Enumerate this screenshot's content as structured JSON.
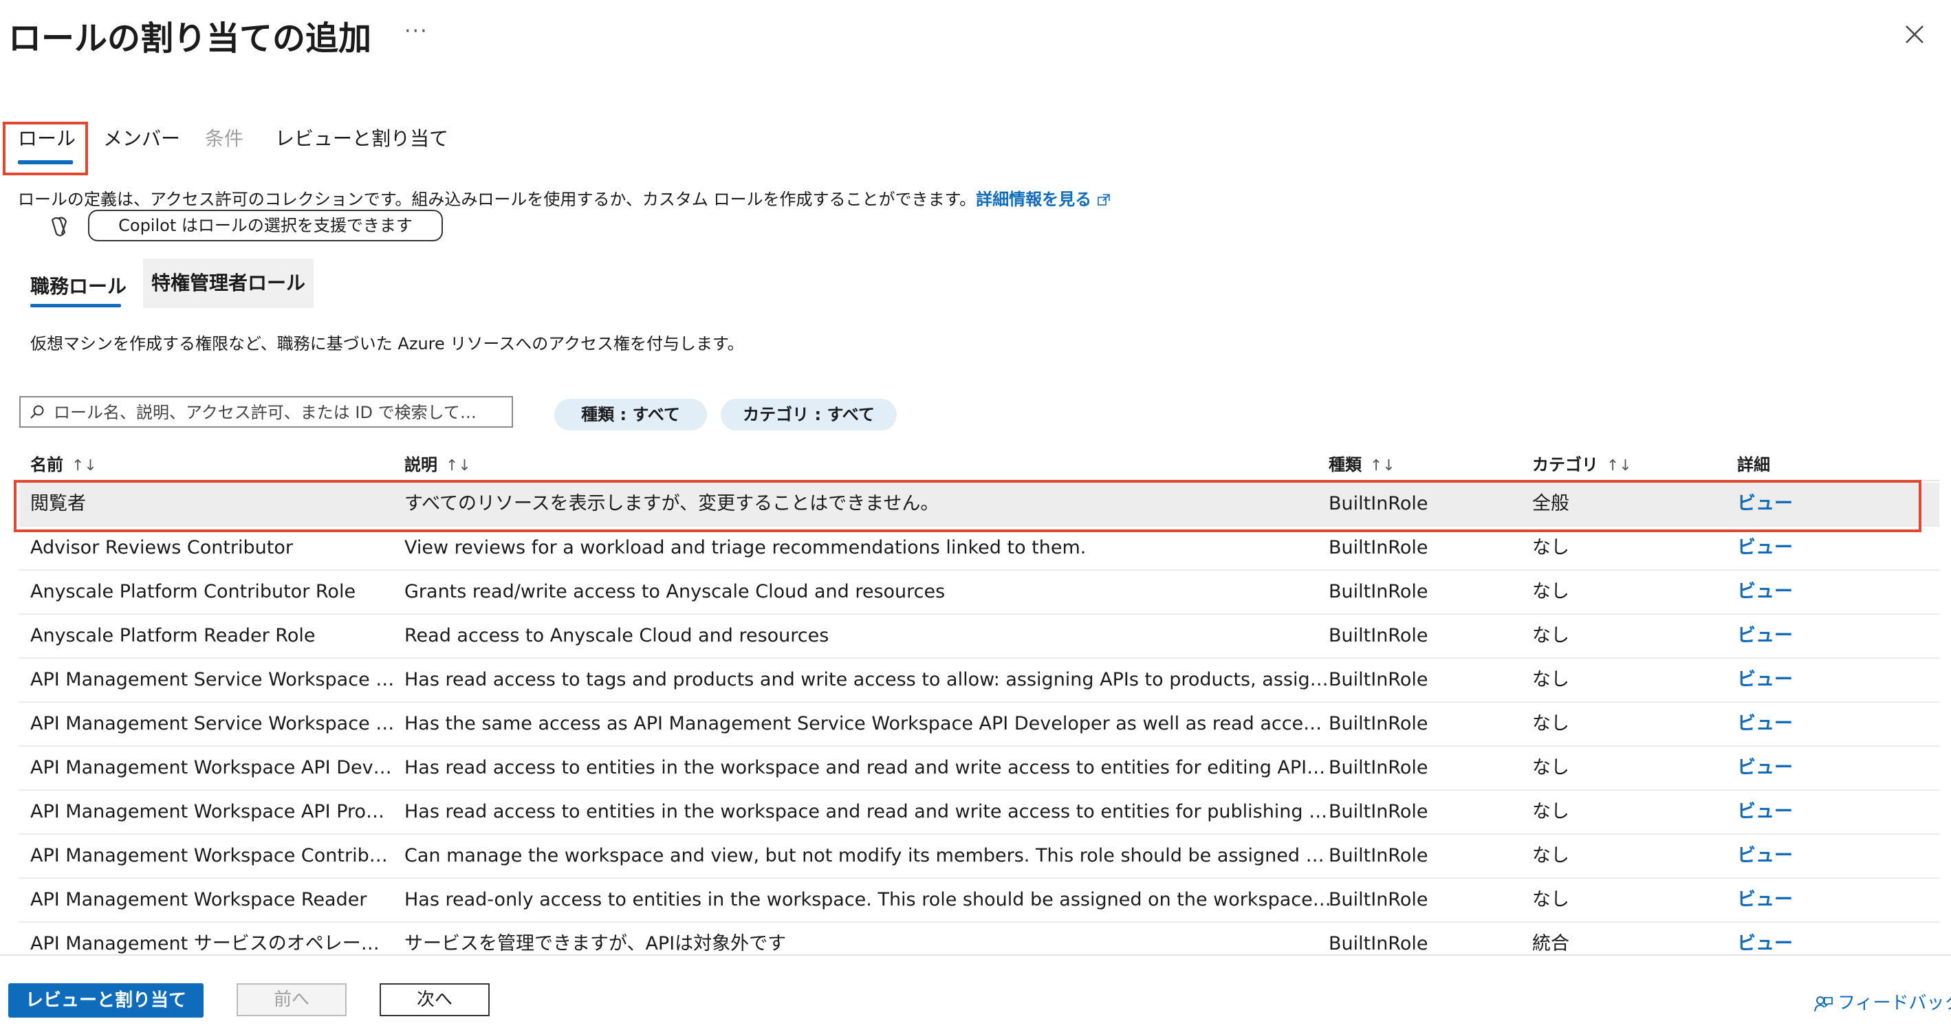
{
  "header": {
    "title": "ロールの割り当ての追加",
    "more": "···"
  },
  "tabs": [
    {
      "label": "ロール"
    },
    {
      "label": "メンバー"
    },
    {
      "label": "条件"
    },
    {
      "label": "レビューと割り当て"
    }
  ],
  "description": {
    "text": "ロールの定義は、アクセス許可のコレクションです。組み込みロールを使用するか、カスタム ロールを作成することができます。",
    "link": "詳細情報を見る"
  },
  "copilot": {
    "button_label": "Copilot はロールの選択を支援できます"
  },
  "subtabs": [
    {
      "label": "職務ロール"
    },
    {
      "label": "特権管理者ロール"
    }
  ],
  "subtab_description": "仮想マシンを作成する権限など、職務に基づいた Azure リソースへのアクセス権を付与します。",
  "search": {
    "placeholder": "ロール名、説明、アクセス許可、または ID で検索して…",
    "value": ""
  },
  "filters": [
    {
      "label": "種類 : すべて"
    },
    {
      "label": "カテゴリ : すべて"
    }
  ],
  "table": {
    "columns": {
      "name": "名前",
      "description": "説明",
      "type": "種類",
      "category": "カテゴリ",
      "details": "詳細"
    },
    "sort_glyph": "↑↓",
    "rows": [
      {
        "name": "閲覧者",
        "description": "すべてのリソースを表示しますが、変更することはできません。",
        "type": "BuiltInRole",
        "category": "全般",
        "details": "ビュー"
      },
      {
        "name": "Advisor Reviews Contributor",
        "description": "View reviews for a workload and triage recommendations linked to them.",
        "type": "BuiltInRole",
        "category": "なし",
        "details": "ビュー"
      },
      {
        "name": "Anyscale Platform Contributor Role",
        "description": "Grants read/write access to Anyscale Cloud and resources",
        "type": "BuiltInRole",
        "category": "なし",
        "details": "ビュー"
      },
      {
        "name": "Anyscale Platform Reader Role",
        "description": "Read access to Anyscale Cloud and resources",
        "type": "BuiltInRole",
        "category": "なし",
        "details": "ビュー"
      },
      {
        "name": "API Management Service Workspace API…",
        "description": "Has read access to tags and products and write access to allow: assigning APIs to products, assigning ta…",
        "type": "BuiltInRole",
        "category": "なし",
        "details": "ビュー"
      },
      {
        "name": "API Management Service Workspace API…",
        "description": "Has the same access as API Management Service Workspace API Developer as well as read access to use…",
        "type": "BuiltInRole",
        "category": "なし",
        "details": "ビュー"
      },
      {
        "name": "API Management Workspace API Develo…",
        "description": "Has read access to entities in the workspace and read and write access to entities for editing APIs. This r…",
        "type": "BuiltInRole",
        "category": "なし",
        "details": "ビュー"
      },
      {
        "name": "API Management Workspace API Product…",
        "description": "Has read access to entities in the workspace and read and write access to entities for publishing APIs. Th…",
        "type": "BuiltInRole",
        "category": "なし",
        "details": "ビュー"
      },
      {
        "name": "API Management Workspace Contributor",
        "description": "Can manage the workspace and view, but not modify its members. This role should be assigned on the w…",
        "type": "BuiltInRole",
        "category": "なし",
        "details": "ビュー"
      },
      {
        "name": "API Management Workspace Reader",
        "description": "Has read-only access to entities in the workspace. This role should be assigned on the workspace scope.",
        "type": "BuiltInRole",
        "category": "なし",
        "details": "ビュー"
      },
      {
        "name": "API Management サービスのオペレーター ロ…",
        "description": "サービスを管理できますが、APIは対象外です",
        "type": "BuiltInRole",
        "category": "統合",
        "details": "ビュー"
      }
    ]
  },
  "footer": {
    "review_assign": "レビューと割り当て",
    "prev": "前へ",
    "next": "次へ",
    "feedback": "フィードバック"
  },
  "colors": {
    "accent": "#0f6cbd",
    "highlight": "#e0492f",
    "pill": "#e1edf7"
  }
}
